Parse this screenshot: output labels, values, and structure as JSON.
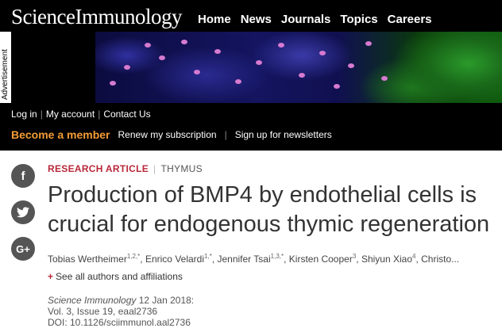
{
  "header": {
    "logo_science": "Science",
    "logo_immunology": "Immunology",
    "nav": [
      "Home",
      "News",
      "Journals",
      "Topics",
      "Careers"
    ],
    "advertisement_label": "Advertisement"
  },
  "user_links": {
    "login": "Log in",
    "my_account": "My account",
    "contact": "Contact Us",
    "separator": "|"
  },
  "membership": {
    "become_member": "Become a member",
    "renew": "Renew my subscription",
    "newsletters": "Sign up for newsletters",
    "separator": "|"
  },
  "social": {
    "facebook_glyph": "f",
    "twitter_glyph": "❧",
    "google_glyph": "G+"
  },
  "article": {
    "type": "RESEARCH ARTICLE",
    "section_sep": "|",
    "topic": "THYMUS",
    "title": "Production of BMP4 by endothelial cells is crucial for endogenous thymic regeneration",
    "authors": [
      {
        "name": "Tobias Wertheimer",
        "sup": "1,2,*"
      },
      {
        "name": "Enrico Velardi",
        "sup": "1,*"
      },
      {
        "name": "Jennifer Tsai",
        "sup": "1,3,*"
      },
      {
        "name": "Kirsten Cooper",
        "sup": "3"
      },
      {
        "name": "Shiyun Xiao",
        "sup": "4"
      },
      {
        "name": "Christo...",
        "sup": ""
      }
    ],
    "see_all_plus": "+",
    "see_all": "See all authors and affiliations",
    "journal": "Science Immunology",
    "date": "12 Jan 2018:",
    "volume": "Vol. 3, Issue 19, eaal2736",
    "doi": "DOI: 10.1126/sciimmunol.aal2736"
  },
  "colors": {
    "accent_red": "#b9283a",
    "member_orange": "#f39c36",
    "header_black": "#000000"
  }
}
